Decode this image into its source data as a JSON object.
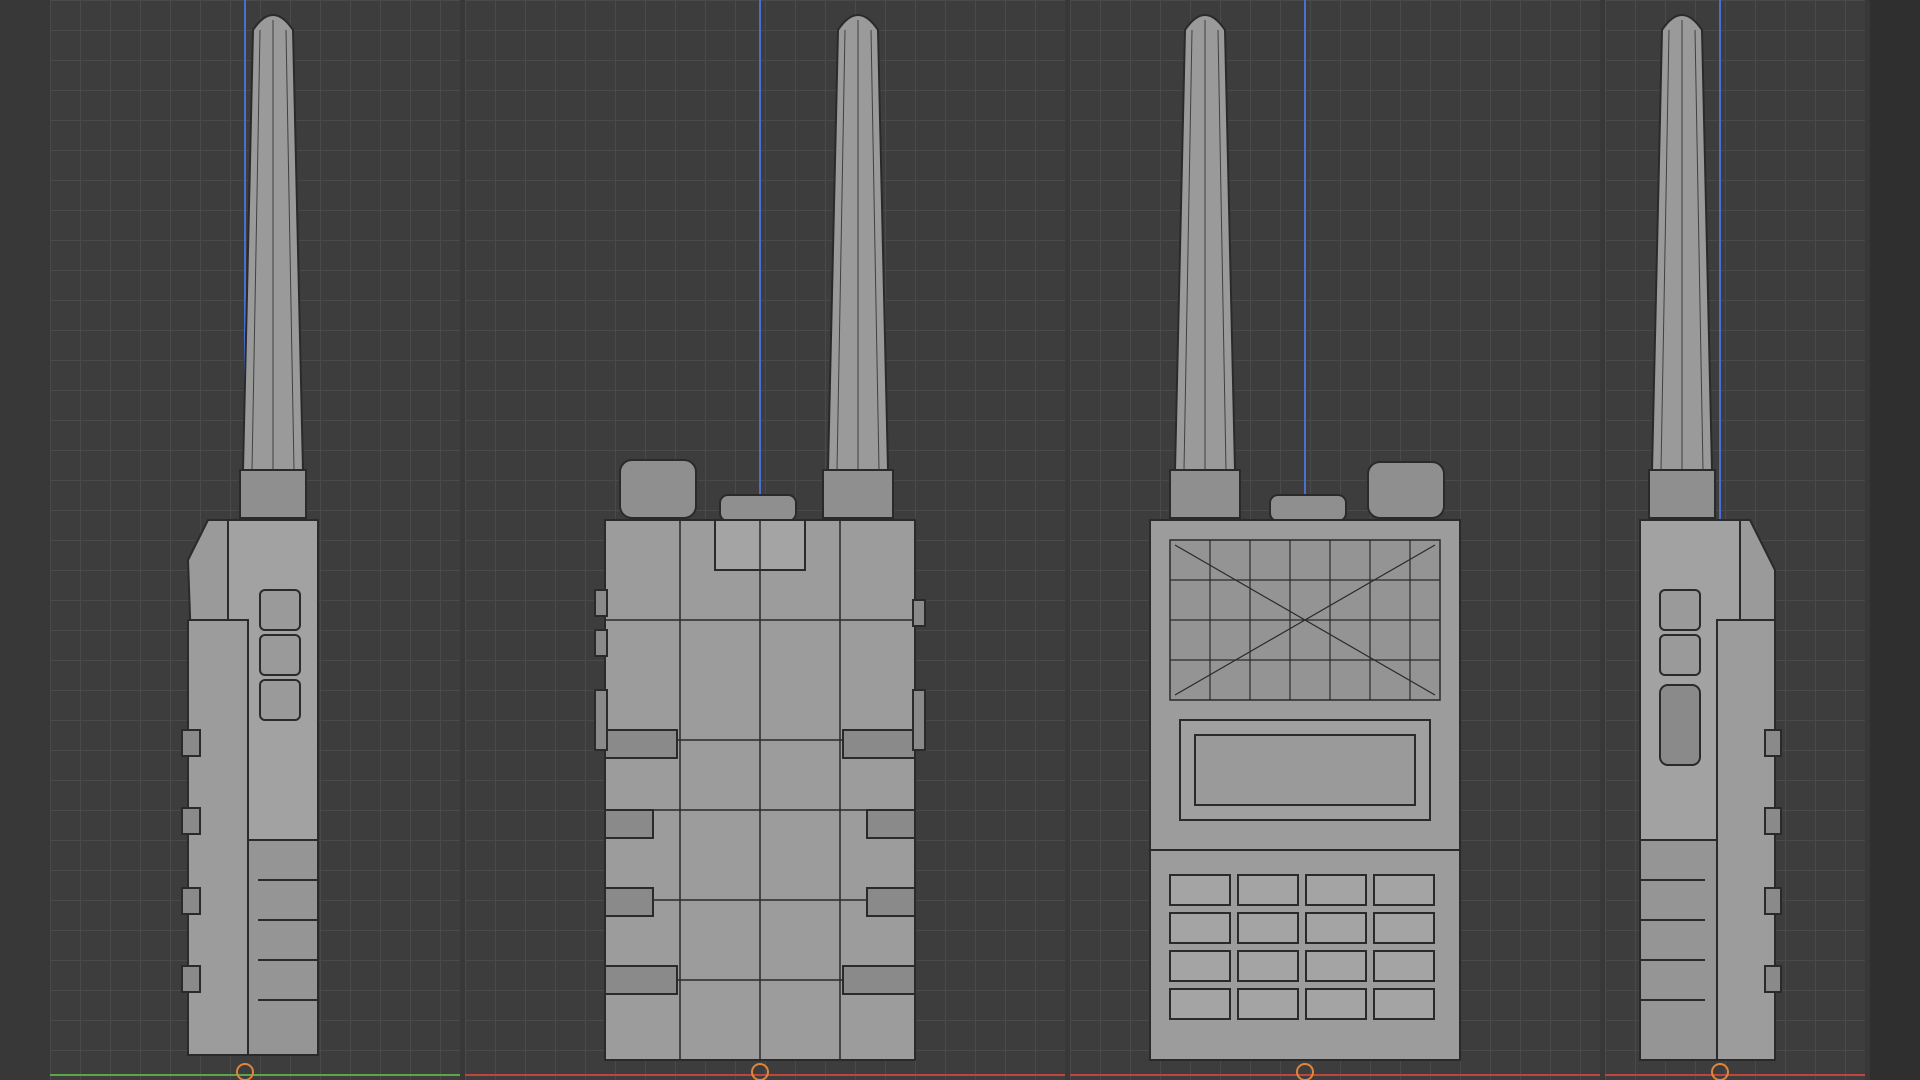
{
  "colors": {
    "background": "#3d3d3d",
    "grid": "#4a4a4a",
    "mesh_fill": "#9a9a9a",
    "mesh_wire": "#2a2a2a",
    "axis_z": "#4a6fd1",
    "axis_x": "#c0453d",
    "axis_y": "#5ea54a",
    "origin": "#e0853a"
  },
  "viewports": [
    {
      "view": "side-left"
    },
    {
      "view": "back"
    },
    {
      "view": "front"
    },
    {
      "view": "side-right"
    }
  ]
}
